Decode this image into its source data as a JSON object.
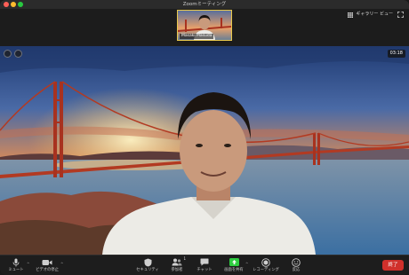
{
  "window": {
    "title": "Zoomミーティング",
    "traffic_colors": [
      "#fe5f57",
      "#febc2e",
      "#28c840"
    ]
  },
  "thumbnail": {
    "name": "Masaki Masuda"
  },
  "view_switch": {
    "label": "ギャラリー ビュー",
    "icon": "grid-icon"
  },
  "meeting": {
    "elapsed": "03:18"
  },
  "toolbar": {
    "mute": {
      "label": "ミュート",
      "icon": "microphone-icon"
    },
    "video": {
      "label": "ビデオの停止",
      "icon": "video-camera-icon"
    },
    "security": {
      "label": "セキュリティ",
      "icon": "shield-icon"
    },
    "participants": {
      "label": "参加者",
      "icon": "participants-icon",
      "count": "1"
    },
    "chat": {
      "label": "チャット",
      "icon": "chat-bubble-icon"
    },
    "share": {
      "label": "画面を共有",
      "icon": "share-screen-icon"
    },
    "record": {
      "label": "レコーディング",
      "icon": "record-icon"
    },
    "reactions": {
      "label": "反応",
      "icon": "smiley-icon"
    },
    "end": {
      "label": "終了"
    }
  },
  "colors": {
    "accent_share": "#2ecc40",
    "end": "#d0302b",
    "thumb_border": "#e9c94c"
  }
}
